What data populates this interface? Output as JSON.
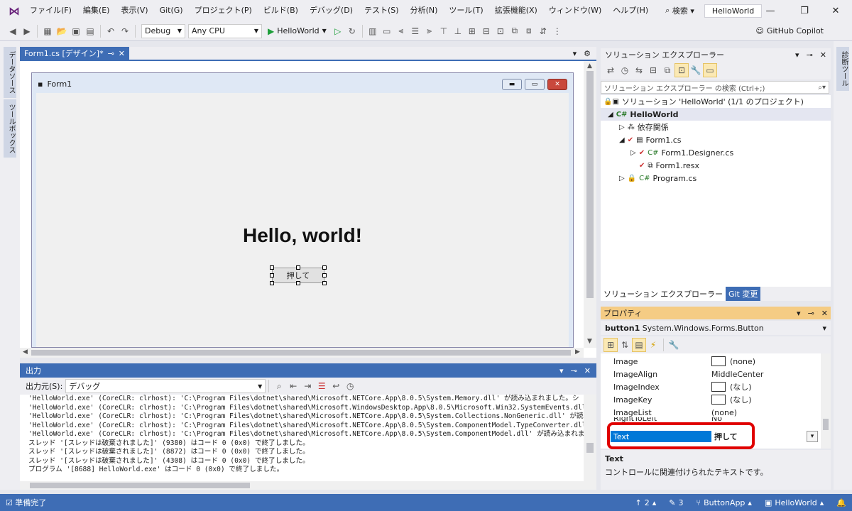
{
  "menubar": {
    "items": [
      "ファイル(F)",
      "編集(E)",
      "表示(V)",
      "Git(G)",
      "プロジェクト(P)",
      "ビルド(B)",
      "デバッグ(D)",
      "テスト(S)",
      "分析(N)",
      "ツール(T)",
      "拡張機能(X)",
      "ウィンドウ(W)",
      "ヘルプ(H)"
    ],
    "search_label": "検索",
    "solution_name": "HelloWorld"
  },
  "toolbar": {
    "config": "Debug",
    "platform": "Any CPU",
    "run_label": "HelloWorld",
    "copilot_label": "GitHub Copilot"
  },
  "left_rail": {
    "tabs": [
      "データソース",
      "ツールボックス"
    ]
  },
  "right_rail": {
    "tabs": [
      "診断ツール"
    ]
  },
  "document": {
    "tab_title": "Form1.cs [デザイン]*"
  },
  "form": {
    "title": "Form1",
    "label_text": "Hello, world!",
    "button_text": "押して"
  },
  "output": {
    "title": "出力",
    "source_label": "出力元(S):",
    "source_value": "デバッグ",
    "lines": [
      "'HelloWorld.exe' (CoreCLR: clrhost): 'C:\\Program Files\\dotnet\\shared\\Microsoft.NETCore.App\\8.0.5\\System.Memory.dll' が読み込まれました。シ",
      "'HelloWorld.exe' (CoreCLR: clrhost): 'C:\\Program Files\\dotnet\\shared\\Microsoft.WindowsDesktop.App\\8.0.5\\Microsoft.Win32.SystemEvents.dll' が",
      "'HelloWorld.exe' (CoreCLR: clrhost): 'C:\\Program Files\\dotnet\\shared\\Microsoft.NETCore.App\\8.0.5\\System.Collections.NonGeneric.dll' が読み込",
      "'HelloWorld.exe' (CoreCLR: clrhost): 'C:\\Program Files\\dotnet\\shared\\Microsoft.NETCore.App\\8.0.5\\System.ComponentModel.TypeConverter.dll' が",
      "'HelloWorld.exe' (CoreCLR: clrhost): 'C:\\Program Files\\dotnet\\shared\\Microsoft.NETCore.App\\8.0.5\\System.ComponentModel.dll' が読み込まれまし",
      "スレッド '[スレッドは破棄されました]' (9380) はコード 0 (0x0) で終了しました。",
      "スレッド '[スレッドは破棄されました]' (8872) はコード 0 (0x0) で終了しました。",
      "スレッド '[スレッドは破棄されました]' (4308) はコード 0 (0x0) で終了しました。",
      "プログラム '[8688] HelloWorld.exe' はコード 0 (0x0) で終了しました。"
    ]
  },
  "solution_explorer": {
    "title": "ソリューション エクスプローラー",
    "search_placeholder": "ソリューション エクスプローラー の検索 (Ctrl+;)",
    "tree": {
      "solution": "ソリューション 'HelloWorld' (1/1 のプロジェクト)",
      "project": "HelloWorld",
      "deps": "依存関係",
      "form1": "Form1.cs",
      "designer": "Form1.Designer.cs",
      "resx": "Form1.resx",
      "program": "Program.cs"
    },
    "tabs": [
      "ソリューション エクスプローラー",
      "Git 変更"
    ]
  },
  "properties": {
    "title": "プロパティ",
    "object": "button1",
    "object_type": "System.Windows.Forms.Button",
    "rows": [
      {
        "name": "Image",
        "value": "(none)",
        "swatch": true
      },
      {
        "name": "ImageAlign",
        "value": "MiddleCenter",
        "swatch": false
      },
      {
        "name": "ImageIndex",
        "value": "(なし)",
        "swatch": true
      },
      {
        "name": "ImageKey",
        "value": "(なし)",
        "swatch": true
      },
      {
        "name": "ImageList",
        "value": "(none)",
        "swatch": false
      },
      {
        "name": "RightToLeft",
        "value": "No",
        "swatch": false
      },
      {
        "name": "Text",
        "value": "押して",
        "swatch": false
      }
    ],
    "desc_title": "Text",
    "desc_text": "コントロールに関連付けられたテキストです。"
  },
  "statusbar": {
    "ready": "準備完了",
    "errors": "2",
    "edits": "3",
    "repo": "ButtonApp",
    "branch": "HelloWorld"
  },
  "colors": {
    "accent": "#3e6db5",
    "highlight": "#e00000",
    "selection": "#0078d7"
  }
}
